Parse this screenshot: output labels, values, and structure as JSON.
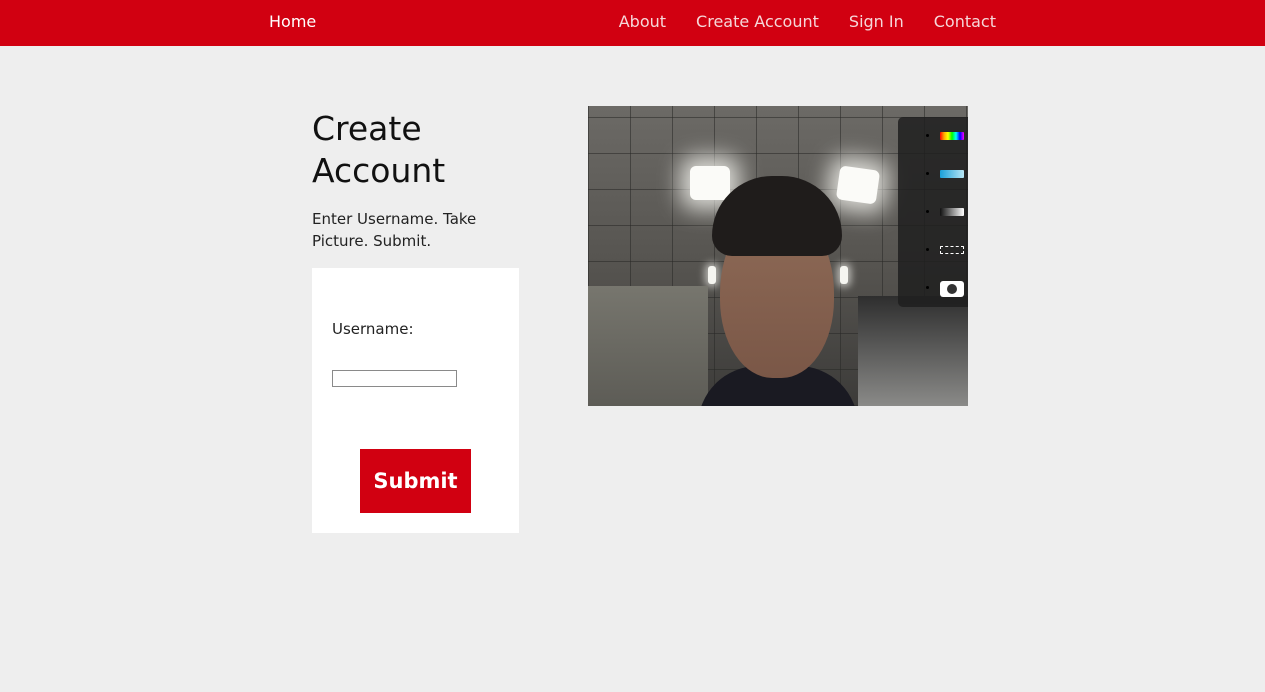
{
  "nav": {
    "home": "Home",
    "links": [
      "About",
      "Create Account",
      "Sign In",
      "Contact"
    ]
  },
  "main": {
    "title": "Create Account",
    "instructions": "Enter Username. Take Picture. Submit."
  },
  "form": {
    "username_label": "Username:",
    "username_value": "",
    "submit_label": "Submit"
  },
  "camera": {
    "toolbar_icons": [
      "rainbow-filter-icon",
      "cyan-filter-icon",
      "grayscale-filter-icon",
      "frame-icon",
      "camera-icon"
    ]
  },
  "colors": {
    "brand_red": "#d10011",
    "page_background": "#eeeeee"
  }
}
